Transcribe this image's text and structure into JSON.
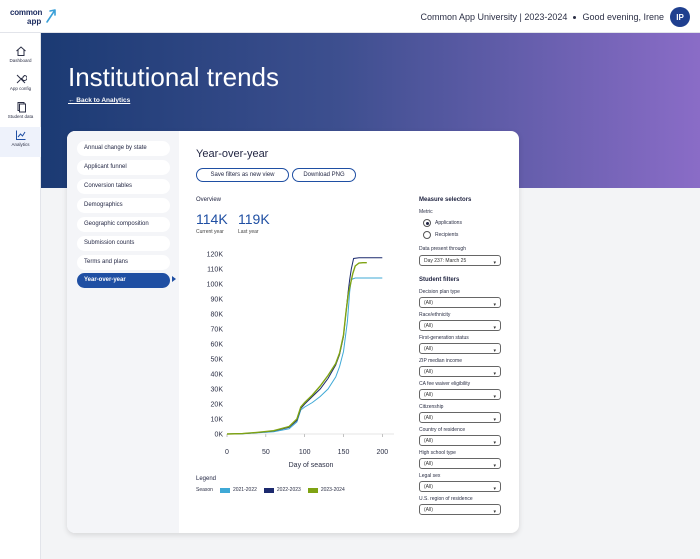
{
  "brand": {
    "line1": "common",
    "line2": "app"
  },
  "header": {
    "university": "Common App University | 2023-2024",
    "greeting": "Good evening, Irene",
    "avatar_initials": "IP"
  },
  "sidenav": [
    {
      "label": "Dashboard",
      "icon": "home-icon"
    },
    {
      "label": "App config",
      "icon": "wrench-icon"
    },
    {
      "label": "Student data",
      "icon": "documents-icon"
    },
    {
      "label": "Analytics",
      "icon": "chart-icon",
      "active": true
    }
  ],
  "hero": {
    "title": "Institutional trends",
    "back_link": "← Back to Analytics"
  },
  "menu": [
    {
      "label": "Annual change by state"
    },
    {
      "label": "Applicant funnel"
    },
    {
      "label": "Conversion tables"
    },
    {
      "label": "Demographics"
    },
    {
      "label": "Geographic composition"
    },
    {
      "label": "Submission counts"
    },
    {
      "label": "Terms and plans"
    },
    {
      "label": "Year-over-year",
      "active": true
    }
  ],
  "main": {
    "title": "Year-over-year",
    "save_btn": "Save filters as new view",
    "download_btn": "Download PNG",
    "overview": "Overview",
    "current_value": "114K",
    "current_label": "Current year",
    "last_value": "119K",
    "last_label": "Last year"
  },
  "chart_data": {
    "type": "line",
    "xlabel": "Day of season",
    "ylabel": "",
    "xlim": [
      0,
      215
    ],
    "ylim": [
      0,
      120000
    ],
    "x_ticks": [
      0,
      50,
      100,
      150,
      200
    ],
    "y_ticks": [
      0,
      10000,
      20000,
      30000,
      40000,
      50000,
      60000,
      70000,
      80000,
      90000,
      100000,
      110000,
      120000
    ],
    "y_tick_labels": [
      "0K",
      "10K",
      "20K",
      "30K",
      "40K",
      "50K",
      "60K",
      "70K",
      "80K",
      "90K",
      "100K",
      "110K",
      "120K"
    ],
    "legend_title": "Legend",
    "legend_prefix": "Season",
    "series": [
      {
        "name": "2021-2022",
        "color": "#3fa9d6",
        "x": [
          0,
          20,
          40,
          60,
          80,
          90,
          95,
          100,
          110,
          120,
          130,
          140,
          145,
          150,
          155,
          158,
          160,
          165,
          200
        ],
        "y": [
          0,
          200,
          800,
          1500,
          3500,
          8000,
          16000,
          18000,
          21000,
          25000,
          30000,
          38000,
          45000,
          55000,
          75000,
          95000,
          103000,
          104000,
          104000
        ]
      },
      {
        "name": "2022-2023",
        "color": "#1c2a6e",
        "x": [
          0,
          20,
          40,
          60,
          80,
          90,
          95,
          100,
          110,
          120,
          130,
          140,
          145,
          150,
          153,
          156,
          158,
          160,
          163,
          170,
          200
        ],
        "y": [
          0,
          300,
          1000,
          2000,
          4500,
          9000,
          17000,
          20000,
          25000,
          30000,
          37000,
          46000,
          53000,
          65000,
          80000,
          95000,
          103000,
          110000,
          117000,
          117500,
          117500
        ]
      },
      {
        "name": "2023-2024",
        "color": "#7fa313",
        "x": [
          0,
          20,
          40,
          60,
          80,
          90,
          95,
          100,
          110,
          120,
          130,
          140,
          145,
          150,
          153,
          156,
          159,
          162,
          165,
          170,
          175,
          180
        ],
        "y": [
          0,
          300,
          1100,
          2200,
          5000,
          10000,
          18000,
          21000,
          26000,
          32000,
          39000,
          47000,
          54000,
          66000,
          80000,
          93000,
          100000,
          107000,
          112000,
          114000,
          114200,
          114200
        ]
      }
    ]
  },
  "measure": {
    "title": "Measure selectors",
    "metric_label": "Metric",
    "options": [
      {
        "label": "Applications",
        "selected": true
      },
      {
        "label": "Recipients",
        "selected": false
      }
    ],
    "data_label": "Data present through",
    "data_value": "Day 237: March 25"
  },
  "filters": {
    "title": "Student filters",
    "items": [
      {
        "label": "Decision plan type",
        "value": "(All)"
      },
      {
        "label": "Race/ethnicity",
        "value": "(All)"
      },
      {
        "label": "First-generation status",
        "value": "(All)"
      },
      {
        "label": "ZIP median income",
        "value": "(All)"
      },
      {
        "label": "CA fee waiver eligibility",
        "value": "(All)"
      },
      {
        "label": "Citizenship",
        "value": "(All)"
      },
      {
        "label": "Country of residence",
        "value": "(All)"
      },
      {
        "label": "High school type",
        "value": "(All)"
      },
      {
        "label": "Legal sex",
        "value": "(All)"
      },
      {
        "label": "U.S. region of residence",
        "value": "(All)"
      }
    ]
  }
}
